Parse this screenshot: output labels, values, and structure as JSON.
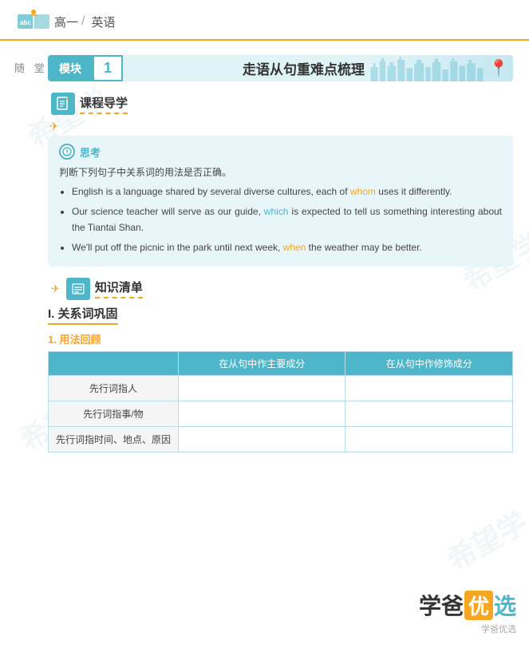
{
  "header": {
    "logo_text": "abc",
    "grade": "高一",
    "subject": "英语",
    "divider": "/"
  },
  "sidebar": {
    "label": "随 堂 笔 记"
  },
  "module": {
    "tag": "模块",
    "number": "1",
    "title": "走语从句重难点梳理",
    "pin_icon": "📍"
  },
  "section1": {
    "label": "课程导学"
  },
  "think": {
    "title": "思考",
    "intro": "判断下列句子中关系词的用法是否正确。",
    "items": [
      {
        "text_before": "English is a language shared by several diverse cultures, each of ",
        "highlight": "whom",
        "highlight_color": "orange",
        "text_after": " uses it differently."
      },
      {
        "text_before": "Our science teacher will serve as our guide, ",
        "highlight": "which",
        "highlight_color": "teal",
        "text_after": " is expected to tell us something interesting about the Tiantai Shan."
      },
      {
        "text_before": "We'll put off the picnic in the park until next week, ",
        "highlight": "when",
        "highlight_color": "orange",
        "text_after": " the weather may be better."
      }
    ]
  },
  "section2": {
    "label": "知识清单"
  },
  "part": {
    "title": "I. 关系词巩固",
    "sub_title": "1. 用法回顾"
  },
  "table": {
    "headers": [
      "",
      "在从句中作主要成分",
      "在从句中作修饰成分"
    ],
    "rows": [
      [
        "先行词指人",
        "",
        ""
      ],
      [
        "先行词指事/物",
        "",
        ""
      ],
      [
        "先行词指时间、地点、原因",
        "",
        ""
      ]
    ]
  },
  "footer": {
    "brand_main_1": "学爸",
    "brand_you": "优",
    "brand_main_2": "选",
    "brand_sub": "学爸优选"
  },
  "watermarks": [
    "希望学",
    "希望学",
    "希望学",
    "希望学"
  ]
}
